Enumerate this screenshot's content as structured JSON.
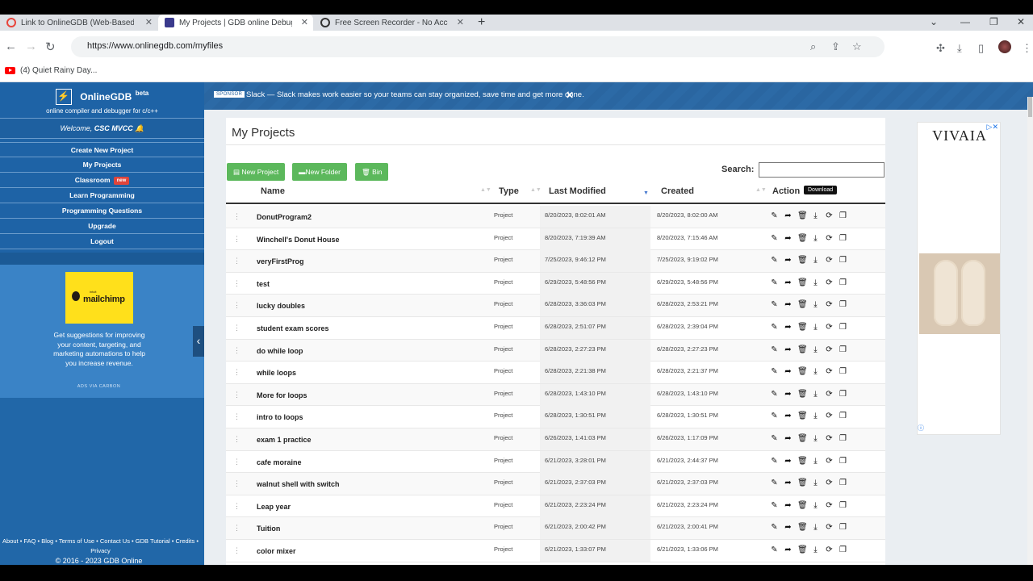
{
  "browser": {
    "tabs": [
      {
        "title": "Link to OnlineGDB (Web-Based C",
        "color": "#e8453c"
      },
      {
        "title": "My Projects | GDB online Debugg",
        "color": "#3a3a8c"
      },
      {
        "title": "Free Screen Recorder - No Accou",
        "color": "#333333"
      }
    ],
    "url": "https://www.onlinegdb.com/myfiles",
    "bookmark": "(4) Quiet Rainy Day..."
  },
  "sidebar": {
    "logo_name": "OnlineGDB",
    "logo_sup": "beta",
    "logo_sub": "online compiler and debugger for c/c++",
    "welcome_prefix": "Welcome, ",
    "welcome_user": "CSC MVCC",
    "menu": [
      {
        "label": "Create New Project"
      },
      {
        "label": "My Projects"
      },
      {
        "label": "Classroom",
        "badge": "new"
      },
      {
        "label": "Learn Programming"
      },
      {
        "label": "Programming Questions"
      },
      {
        "label": "Upgrade"
      },
      {
        "label": "Logout"
      }
    ],
    "ad": {
      "brand": "mailchimp",
      "brand_pre": "intuit",
      "text": "Get suggestions for improving your content, targeting, and marketing automations to help you increase revenue.",
      "via": "ADS VIA CARBON"
    },
    "footer_links": "About • FAQ • Blog • Terms of Use • Contact Us • GDB Tutorial • Credits • Privacy",
    "copyright": "© 2016 - 2023 GDB Online"
  },
  "sponsor": {
    "label": "SPONSOR",
    "text": "Slack — Slack makes work easier so your teams can stay organized, save time and get more done."
  },
  "main": {
    "title": "My Projects",
    "buttons": {
      "new_project": "New Project",
      "new_folder": "New Folder",
      "bin": "Bin"
    },
    "search_label": "Search:",
    "search_value": "",
    "columns": {
      "name": "Name",
      "type": "Type",
      "modified": "Last Modified",
      "created": "Created",
      "action": "Action"
    },
    "tooltip": "Download",
    "rows": [
      {
        "name": "DonutProgram2",
        "type": "Project",
        "modified": "8/20/2023, 8:02:01 AM",
        "created": "8/20/2023, 8:02:00 AM"
      },
      {
        "name": "Winchell's Donut House",
        "type": "Project",
        "modified": "8/20/2023, 7:19:39 AM",
        "created": "8/20/2023, 7:15:46 AM"
      },
      {
        "name": "veryFirstProg",
        "type": "Project",
        "modified": "7/25/2023, 9:46:12 PM",
        "created": "7/25/2023, 9:19:02 PM"
      },
      {
        "name": "test",
        "type": "Project",
        "modified": "6/29/2023, 5:48:56 PM",
        "created": "6/29/2023, 5:48:56 PM"
      },
      {
        "name": "lucky doubles",
        "type": "Project",
        "modified": "6/28/2023, 3:36:03 PM",
        "created": "6/28/2023, 2:53:21 PM"
      },
      {
        "name": "student exam scores",
        "type": "Project",
        "modified": "6/28/2023, 2:51:07 PM",
        "created": "6/28/2023, 2:39:04 PM"
      },
      {
        "name": "do while loop",
        "type": "Project",
        "modified": "6/28/2023, 2:27:23 PM",
        "created": "6/28/2023, 2:27:23 PM"
      },
      {
        "name": "while loops",
        "type": "Project",
        "modified": "6/28/2023, 2:21:38 PM",
        "created": "6/28/2023, 2:21:37 PM"
      },
      {
        "name": "More for loops",
        "type": "Project",
        "modified": "6/28/2023, 1:43:10 PM",
        "created": "6/28/2023, 1:43:10 PM"
      },
      {
        "name": "intro to loops",
        "type": "Project",
        "modified": "6/28/2023, 1:30:51 PM",
        "created": "6/28/2023, 1:30:51 PM"
      },
      {
        "name": "exam 1 practice",
        "type": "Project",
        "modified": "6/26/2023, 1:41:03 PM",
        "created": "6/26/2023, 1:17:09 PM"
      },
      {
        "name": "cafe moraine",
        "type": "Project",
        "modified": "6/21/2023, 3:28:01 PM",
        "created": "6/21/2023, 2:44:37 PM"
      },
      {
        "name": "walnut shell with switch",
        "type": "Project",
        "modified": "6/21/2023, 2:37:03 PM",
        "created": "6/21/2023, 2:37:03 PM"
      },
      {
        "name": "Leap year",
        "type": "Project",
        "modified": "6/21/2023, 2:23:24 PM",
        "created": "6/21/2023, 2:23:24 PM"
      },
      {
        "name": "Tuition",
        "type": "Project",
        "modified": "6/21/2023, 2:00:42 PM",
        "created": "6/21/2023, 2:00:41 PM"
      },
      {
        "name": "color mixer",
        "type": "Project",
        "modified": "6/21/2023, 1:33:07 PM",
        "created": "6/21/2023, 1:33:06 PM"
      }
    ]
  },
  "right_ad": {
    "brand": "VIVAIA"
  },
  "colors": {
    "sidebar": "#2167a8",
    "green": "#5cb85c",
    "accent": "#4a7bd0"
  }
}
